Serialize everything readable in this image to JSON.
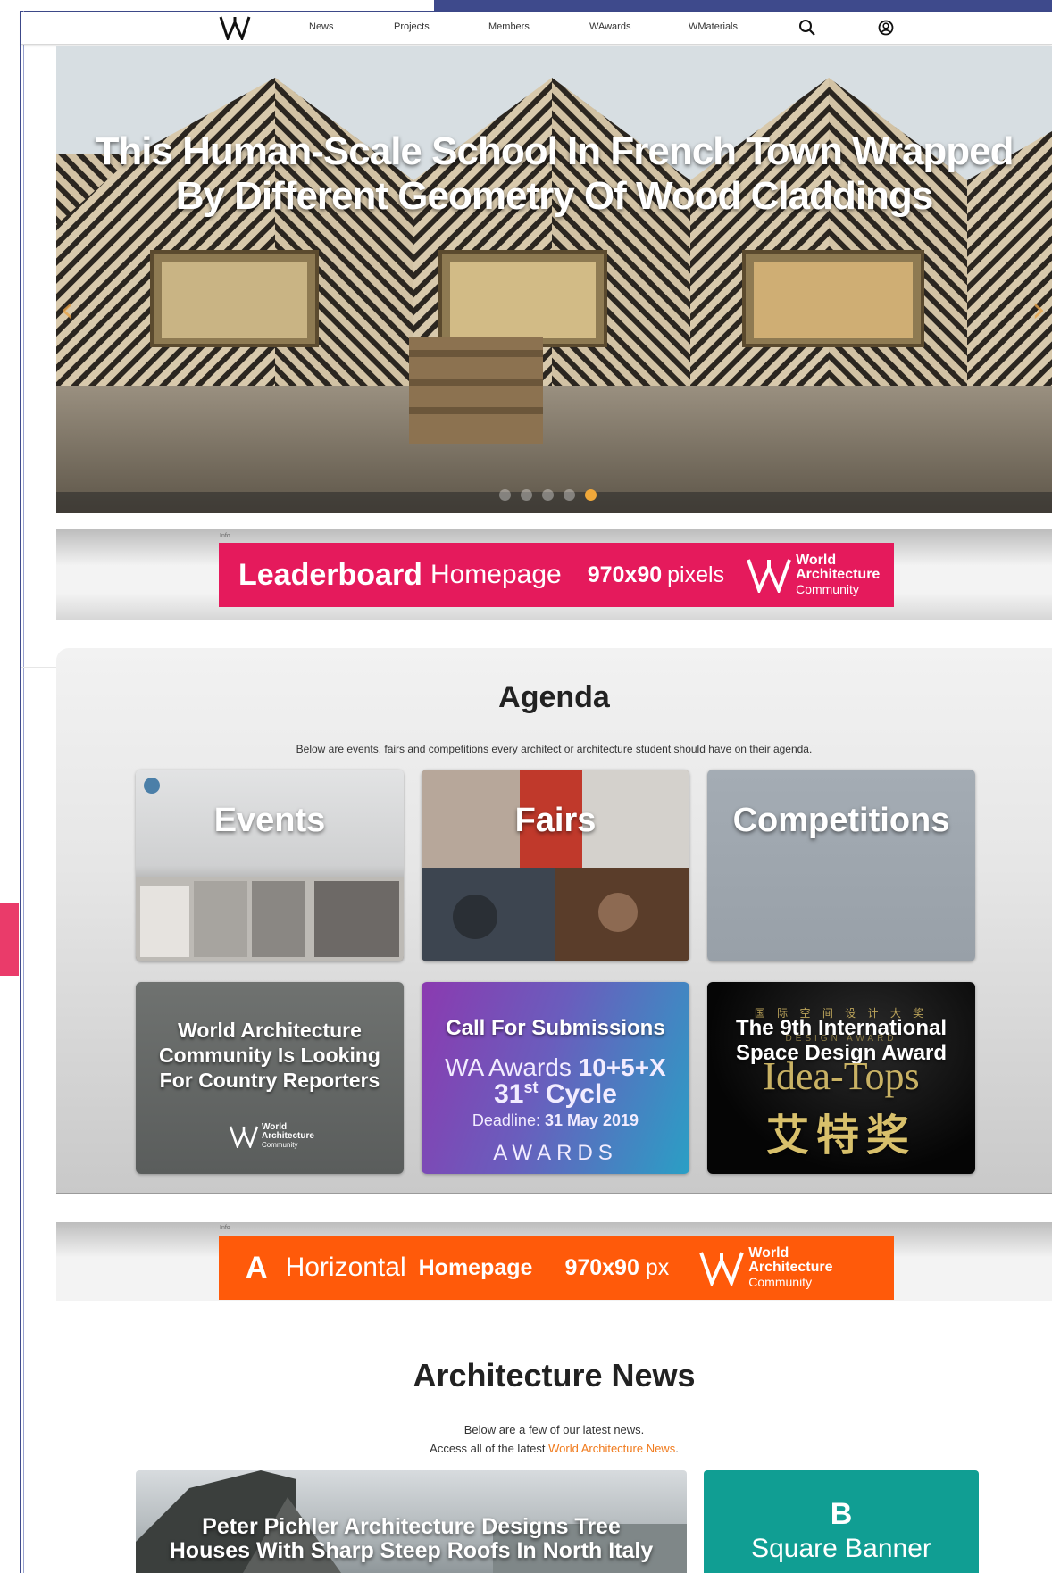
{
  "nav": {
    "items": [
      "News",
      "Projects",
      "Members",
      "WAwards",
      "WMaterials"
    ],
    "logo_icon": "wa-logo-icon",
    "search_icon": "search-icon",
    "account_icon": "user-account-icon"
  },
  "hero": {
    "title_line1": "This Human-Scale School In French Town Wrapped",
    "title_line2": "By Different Geometry Of Wood Claddings",
    "prev_arrow": "‹",
    "next_arrow": "›",
    "slide_count": 5,
    "active_slide": 5
  },
  "ad1": {
    "info": "Info",
    "strong": "Leaderboard",
    "light": "Homepage",
    "size": "970x90",
    "unit": "pixels",
    "brand_line1": "World",
    "brand_line2": "Architecture",
    "brand_line3": "Community",
    "color": "#e51a5c"
  },
  "agenda": {
    "title": "Agenda",
    "subtitle": "Below are events, fairs and competitions every architect or architecture student should have on their agenda.",
    "cards": [
      {
        "label": "Events"
      },
      {
        "label": "Fairs"
      },
      {
        "label": "Competitions"
      }
    ],
    "promo1": {
      "line1": "World Architecture",
      "line2": "Community Is Looking",
      "line3": "For Country Reporters",
      "brand1": "World",
      "brand2": "Architecture",
      "brand3": "Community"
    },
    "promo2": {
      "title": "Call For Submissions",
      "line_a": "WA Awards",
      "line_a_bold": "10+5+X",
      "cycle_num": "31",
      "cycle_sup": "st",
      "cycle_word": "Cycle",
      "deadline_label": "Deadline:",
      "deadline_date": "31 May  2019",
      "awards_word": "AWARDS"
    },
    "promo3": {
      "top_cn": "国 际 空 间 设 计 大 奖",
      "line1": "The 9th International",
      "line2": "Space Design Award",
      "sub_en": "DESIGN AWARD",
      "brand": "Idea-Tops",
      "cn": "艾特奖"
    }
  },
  "ad2": {
    "info": "Info",
    "letter": "A",
    "light": "Horizontal",
    "strong": "Homepage",
    "size": "970x90",
    "unit": "px",
    "brand_line1": "World",
    "brand_line2": "Architecture",
    "brand_line3": "Community",
    "color": "#ff5a0a"
  },
  "news": {
    "title": "Architecture News",
    "sub1": "Below are a few of our latest news.",
    "sub2_prefix": "Access all of the latest ",
    "sub2_link": "World Architecture News",
    "sub2_suffix": ".",
    "card_title_line1": "Peter Pichler Architecture Designs Tree",
    "card_title_line2": "Houses With Sharp Steep Roofs In North Italy",
    "banner_letter": "B",
    "banner_text": "Square Banner"
  }
}
